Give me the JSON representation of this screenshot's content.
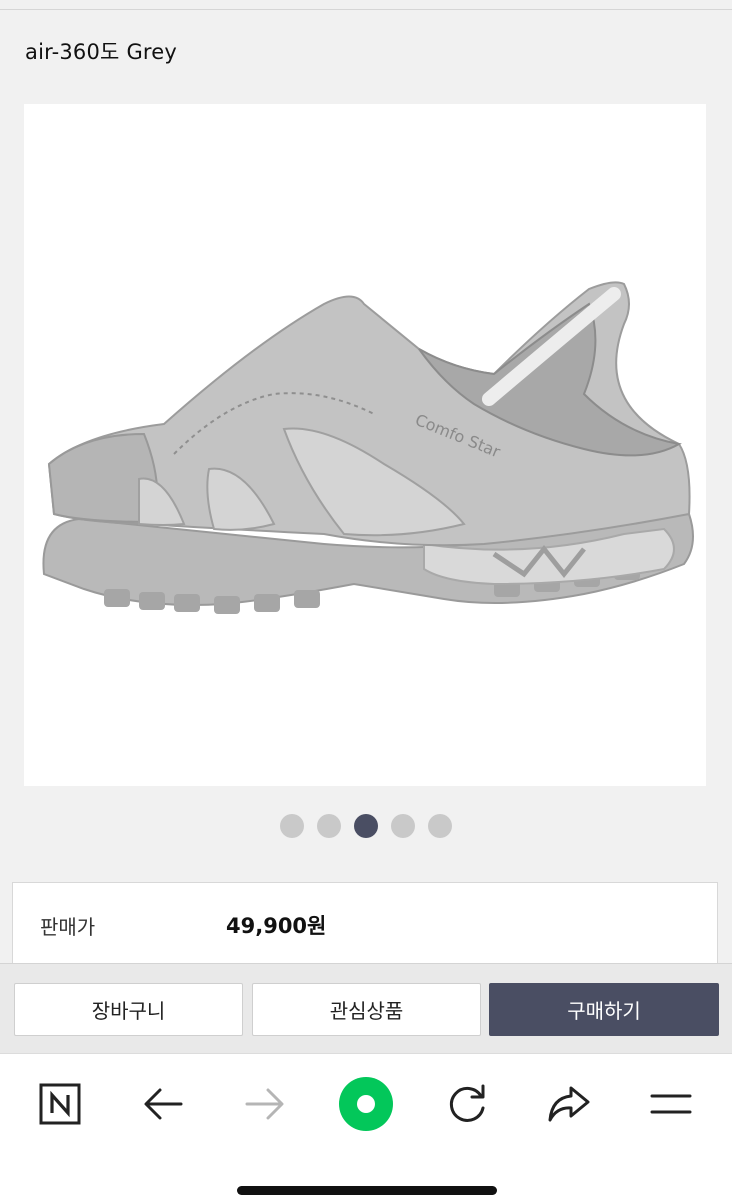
{
  "product": {
    "title": "air-360도 Grey",
    "image_alt": "Comfo Star grey slingback mule shoe",
    "image_logo_text": "Comfo Star"
  },
  "carousel": {
    "count": 5,
    "active_index": 2
  },
  "info": {
    "price_label": "판매가",
    "price_value": "49,900원"
  },
  "actions": {
    "cart_label": "장바구니",
    "wishlist_label": "관심상품",
    "buy_label": "구매하기"
  },
  "browser_nav": {
    "icons": [
      "naver-n-icon",
      "back-arrow-icon",
      "forward-arrow-icon",
      "naver-green-dot-icon",
      "reload-icon",
      "share-icon",
      "menu-icon"
    ]
  },
  "colors": {
    "accent": "#4a4e63",
    "naver_green": "#03c75a",
    "background": "#f1f1f1"
  }
}
